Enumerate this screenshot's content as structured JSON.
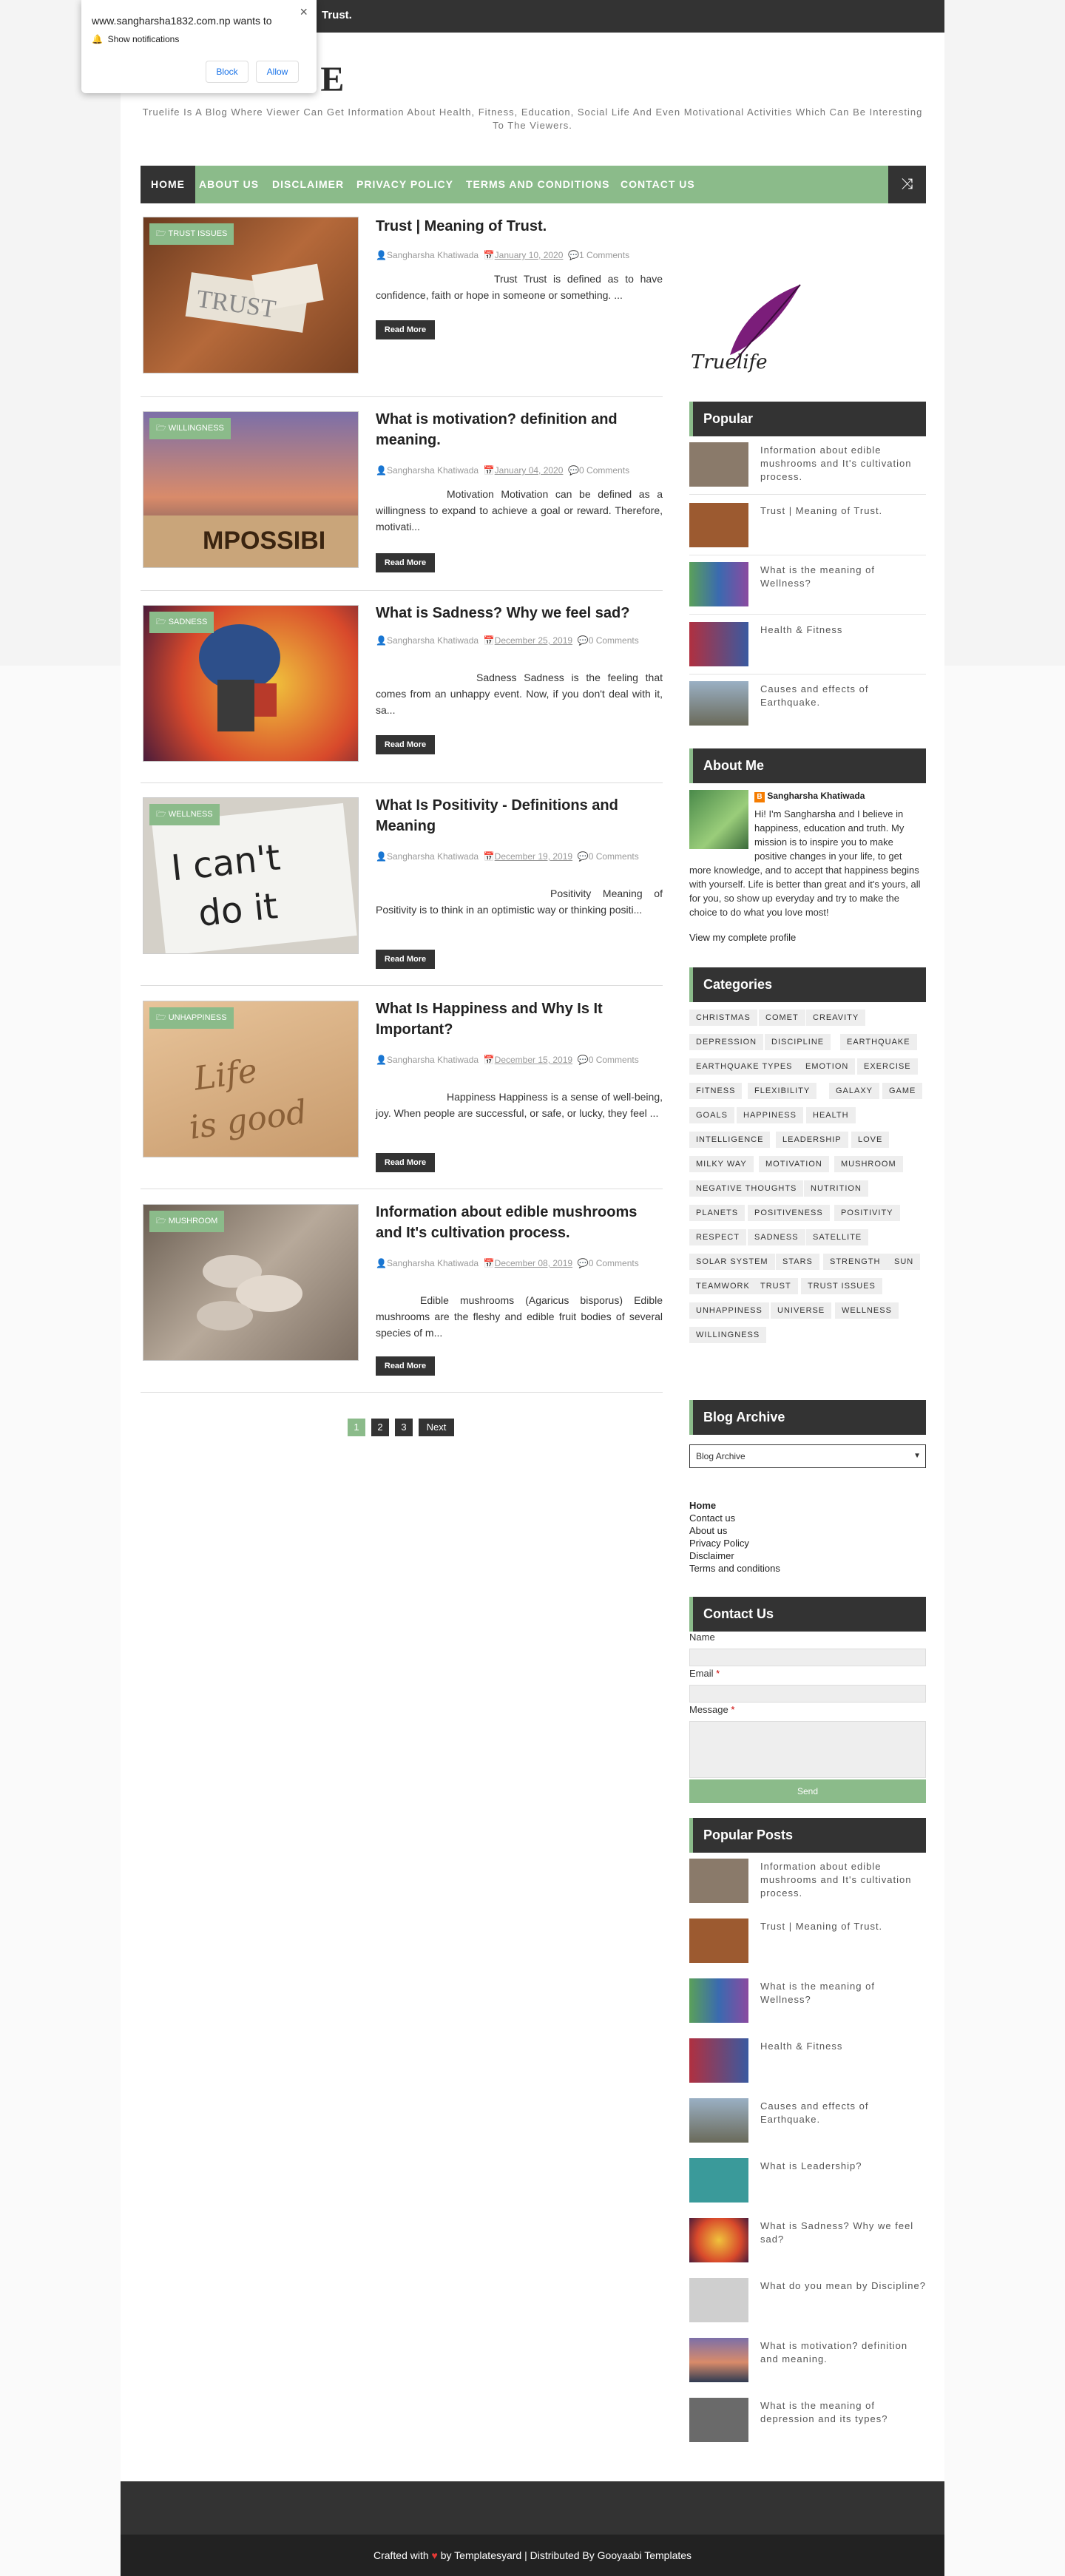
{
  "topbar": {
    "text": "Trust."
  },
  "site": {
    "logo": "FE",
    "tagline": "Truelife Is A Blog Where Viewer Can Get Information About Health, Fitness, Education, Social Life And Even Motivational Activities Which Can Be Interesting To The Viewers."
  },
  "nav": {
    "items": [
      "HOME",
      "ABOUT US",
      "DISCLAIMER",
      "PRIVACY POLICY",
      "TERMS AND CONDITIONS",
      "CONTACT US"
    ],
    "shuffle_icon": "shuffle-icon"
  },
  "posts": [
    {
      "category": "TRUST ISSUES",
      "title": "Trust | Meaning of Trust.",
      "author": "Sangharsha Khatiwada",
      "date": "January 10, 2020",
      "comments": "1 Comments",
      "excerpt": "Trust Trust  is  defined  as to have confidence, faith or hope in someone or something. ...",
      "read_more": "Read More"
    },
    {
      "category": "WILLINGNESS",
      "title": "What is motivation? definition and meaning.",
      "author": "Sangharsha Khatiwada",
      "date": "January 04, 2020",
      "comments": "0 Comments",
      "excerpt": "Motivation Motivation can be defined as a willingness to expand to achieve a goal or reward. Therefore, motivati...",
      "read_more": "Read More"
    },
    {
      "category": "SADNESS",
      "title": "What is Sadness? Why we feel sad?",
      "author": "Sangharsha Khatiwada",
      "date": "December 25, 2019",
      "comments": "0 Comments",
      "excerpt": "Sadness Sadness is the feeling that comes from an unhappy event. Now, if you don't deal with it, sa...",
      "read_more": "Read More"
    },
    {
      "category": "WELLNESS",
      "title": "What Is Positivity - Definitions and Meaning",
      "author": "Sangharsha Khatiwada",
      "date": "December 19, 2019",
      "comments": "0 Comments",
      "excerpt": "Positivity Meaning of Positivity is to  think in an optimistic way or thinking positi...",
      "read_more": "Read More"
    },
    {
      "category": "UNHAPPINESS",
      "title": "What Is Happiness and Why Is It Important?",
      "author": "Sangharsha Khatiwada",
      "date": "December 15, 2019",
      "comments": "0 Comments",
      "excerpt": "Happiness Happiness   is a sense of well-being, joy. When people are successful, or safe, or lucky, they feel  ...",
      "read_more": "Read More"
    },
    {
      "category": "MUSHROOM",
      "title": "Information about edible mushrooms and It's cultivation process.",
      "author": "Sangharsha Khatiwada",
      "date": "December 08, 2019",
      "comments": "0 Comments",
      "excerpt": "Edible mushrooms  (Agaricus bisporus) Edible mushrooms  are the fleshy  and edible fruit bodies  of several species of m...",
      "read_more": "Read More"
    }
  ],
  "pagination": {
    "pages": [
      "1",
      "2",
      "3"
    ],
    "next": "Next"
  },
  "sidebar": {
    "logo_text": "Truelife",
    "popular_title": "Popular",
    "popular": [
      "Information about edible mushrooms and It's cultivation process.",
      "Trust | Meaning of Trust.",
      "What is the meaning of Wellness?",
      "Health & Fitness",
      "Causes and effects of Earthquake."
    ],
    "about_title": "About Me",
    "about_name": "Sangharsha Khatiwada",
    "about_text": "Hi! I'm Sangharsha and I believe in happiness, education and truth. My mission is to inspire you to make positive changes in your life, to get more knowledge, and to accept that happiness begins with yourself. Life is better than great and it's yours, all for you, so show up everyday and try to make the choice to do what you love most!",
    "about_link": "View my complete profile",
    "categories_title": "Categories",
    "categories": [
      "CHRISTMAS",
      "COMET",
      "CREAVITY",
      "DEPRESSION",
      "DISCIPLINE",
      "EARTHQUAKE",
      "EARTHQUAKE TYPES",
      "EMOTION",
      "EXERCISE",
      "FITNESS",
      "FLEXIBILITY",
      "GALAXY",
      "GAME",
      "GOALS",
      "HAPPINESS",
      "HEALTH",
      "INTELLIGENCE",
      "LEADERSHIP",
      "LOVE",
      "MILKY WAY",
      "MOTIVATION",
      "MUSHROOM",
      "NEGATIVE THOUGHTS",
      "NUTRITION",
      "PLANETS",
      "POSITIVENESS",
      "POSITIVITY",
      "RESPECT",
      "SADNESS",
      "SATELLITE",
      "SOLAR SYSTEM",
      "STARS",
      "STRENGTH",
      "SUN",
      "TEAMWORK",
      "TRUST",
      "TRUST ISSUES",
      "UNHAPPINESS",
      "UNIVERSE",
      "WELLNESS",
      "WILLINGNESS"
    ],
    "archive_title": "Blog Archive",
    "archive_select": "Blog Archive",
    "pages_links": [
      "Home",
      "Contact us",
      "About us",
      "Privacy Policy",
      "Disclaimer",
      "Terms and conditions"
    ],
    "contact_title": "Contact Us",
    "contact_name_label": "Name",
    "contact_email_label": "Email",
    "contact_message_label": "Message",
    "required_mark": "*",
    "contact_send": "Send",
    "popular_posts_title": "Popular Posts",
    "popular_posts": [
      "Information about edible mushrooms and It's cultivation process.",
      "Trust | Meaning of Trust.",
      "What is the meaning of Wellness?",
      "Health & Fitness",
      "Causes and effects of Earthquake.",
      "What is Leadership?",
      "What is Sadness? Why we feel sad?",
      "What do you mean by Discipline?",
      "What is motivation? definition and meaning.",
      "What is the meaning of depression and its types?"
    ]
  },
  "footer": {
    "crafted": "Crafted with",
    "heart_icon": "heart-icon",
    "by": "by Templatesyard | Distributed By Gooyaabi Templates"
  },
  "notification": {
    "title": "www.sangharsha1832.com.np wants to",
    "row": "Show notifications",
    "block": "Block",
    "allow": "Allow",
    "bell_icon": "bell-icon",
    "close_icon": "close-icon"
  },
  "colors": {
    "accent": "#8bbb8a",
    "dark": "#333333",
    "heart": "#e53935"
  }
}
